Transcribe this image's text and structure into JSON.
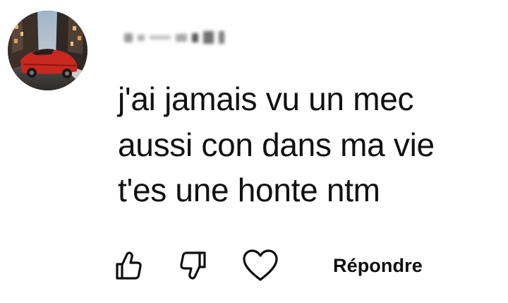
{
  "comment": {
    "username": "",
    "avatar": {
      "icon": "car-avatar-icon"
    },
    "text_lines": [
      "j'ai jamais vu un mec",
      "aussi con dans ma vie",
      "t'es une honte ntm"
    ]
  },
  "actions": {
    "like_icon": "thumbs-up-icon",
    "dislike_icon": "thumbs-down-icon",
    "heart_icon": "heart-icon",
    "reply_label": "Répondre"
  },
  "colors": {
    "text": "#111111",
    "icon_stroke": "#0f0f0f",
    "background": "#ffffff"
  }
}
